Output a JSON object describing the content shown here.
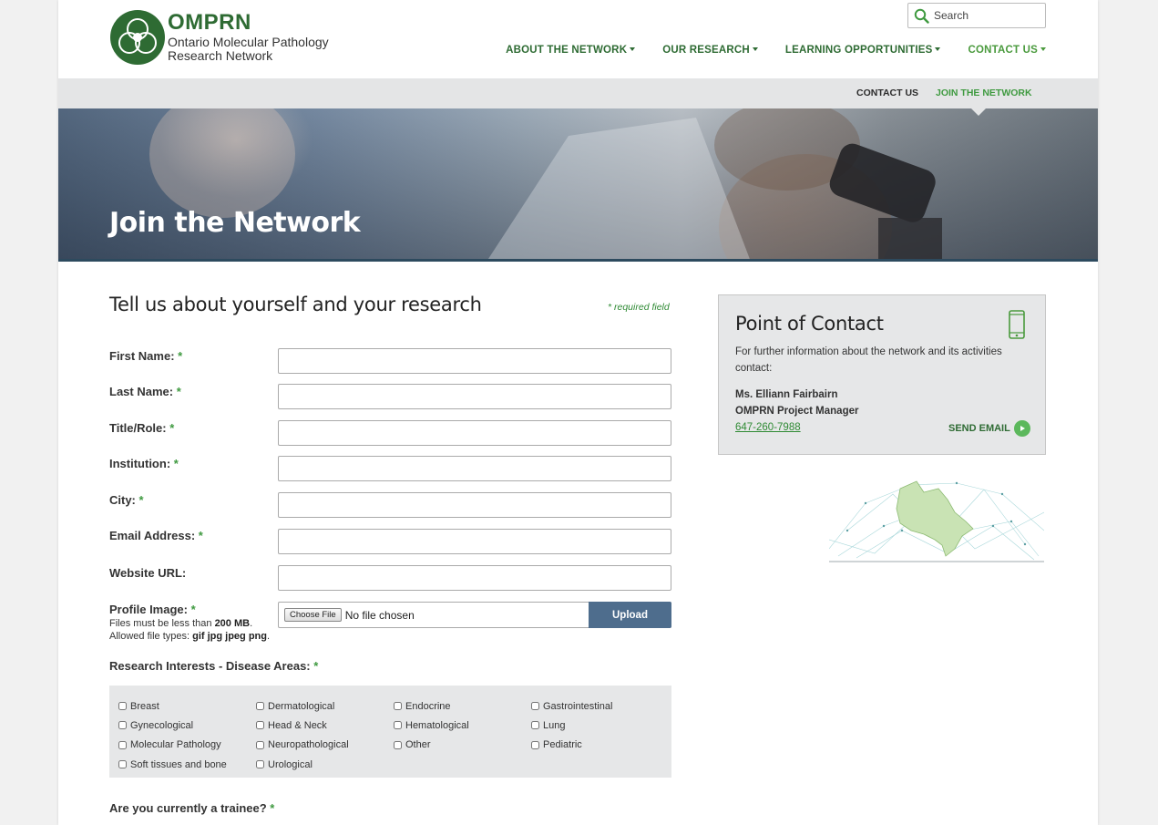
{
  "header": {
    "logo_abbr": "OMPRN",
    "logo_line1": "Ontario Molecular Pathology",
    "logo_line2": "Research Network",
    "search_placeholder": "Search"
  },
  "nav": {
    "items": [
      {
        "label": "ABOUT THE NETWORK"
      },
      {
        "label": "OUR RESEARCH"
      },
      {
        "label": "LEARNING OPPORTUNITIES"
      },
      {
        "label": "CONTACT US"
      }
    ]
  },
  "subnav": {
    "contact": "CONTACT US",
    "join": "JOIN THE NETWORK"
  },
  "hero": {
    "title": "Join the Network"
  },
  "form": {
    "heading": "Tell us about yourself and your research",
    "required_note": "* required field",
    "required_marker": "*",
    "fields": [
      {
        "label": "First Name:",
        "value": ""
      },
      {
        "label": "Last Name:",
        "value": ""
      },
      {
        "label": "Title/Role:",
        "value": ""
      },
      {
        "label": "Institution:",
        "value": ""
      },
      {
        "label": "City:",
        "value": ""
      },
      {
        "label": "Email Address:",
        "value": ""
      },
      {
        "label": "Website URL:",
        "value": ""
      }
    ],
    "profile_image": {
      "label": "Profile Image:",
      "choose_file": "Choose File",
      "file_status": "No file chosen",
      "upload": "Upload",
      "hint1_prefix": "Files must be less than ",
      "hint1_size": "200 MB",
      "hint1_suffix": ".",
      "hint2_prefix": "Allowed file types: ",
      "hint2_types": "gif jpg jpeg png",
      "hint2_suffix": "."
    },
    "interests_label": "Research Interests - Disease Areas:",
    "interests": [
      "Breast",
      "Dermatological",
      "Endocrine",
      "Gastrointestinal",
      "Gynecological",
      "Head & Neck",
      "Hematological",
      "Lung",
      "Molecular Pathology",
      "Neuropathological",
      "Other",
      "Pediatric",
      "Soft tissues and bone",
      "Urological"
    ],
    "trainee_label": "Are you currently a trainee?"
  },
  "contact": {
    "title": "Point of Contact",
    "description": "For further information about the network and its activities contact:",
    "name": "Ms. Elliann Fairbairn",
    "role": "OMPRN Project Manager",
    "phone": "647-260-7988",
    "send_email": "SEND EMAIL"
  },
  "colors": {
    "brand_green": "#2e6b33",
    "accent_green": "#3f9a40",
    "upload_blue": "#4e6d8d"
  }
}
